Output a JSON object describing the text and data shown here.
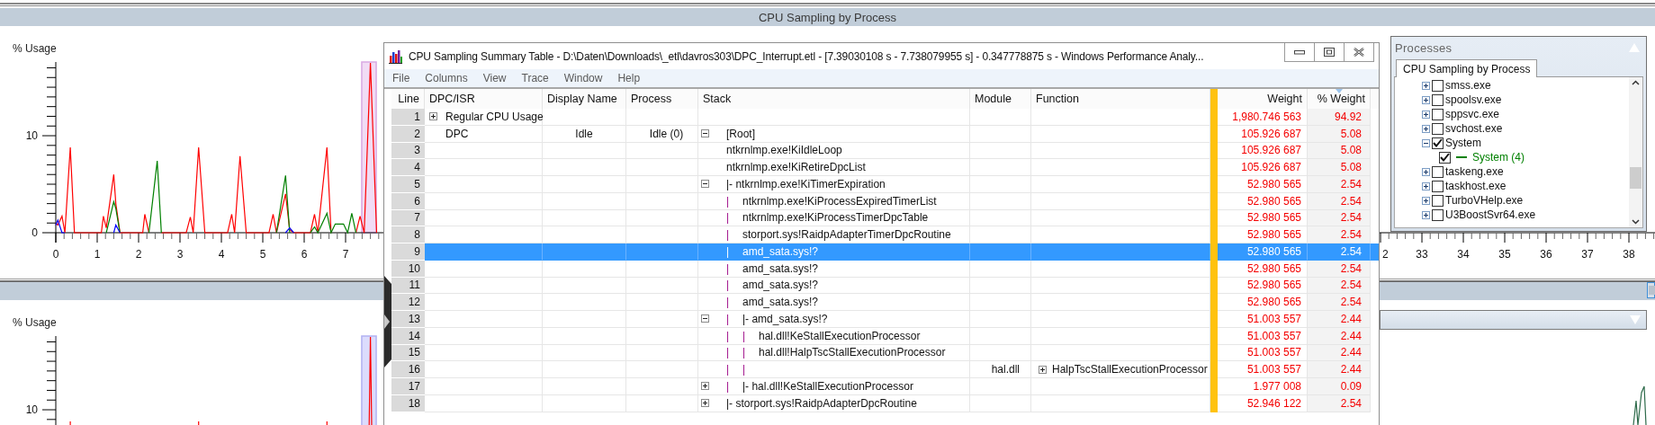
{
  "top_pane": {
    "title": "CPU Sampling by Process",
    "chart_data": {
      "type": "line",
      "ylabel": "% Usage",
      "x": [
        0,
        0.05,
        0.15,
        0.22,
        0.35,
        0.45,
        1.1,
        1.15,
        1.22,
        1.4,
        1.45,
        1.55,
        2.1,
        2.15,
        2.25,
        2.45,
        2.55,
        3.15,
        3.25,
        3.32,
        3.45,
        3.6,
        4.15,
        4.25,
        4.32,
        4.45,
        4.6,
        5.15,
        5.25,
        5.33,
        5.55,
        5.65,
        5.75,
        6.15,
        6.25,
        6.33,
        6.55,
        6.65,
        6.75,
        6.95,
        7.05,
        7.15,
        7.25,
        7.35,
        7.45,
        7.6,
        7.75
      ],
      "series": [
        {
          "color": "#ff0000",
          "values": [
            1.0,
            0.8,
            1.7,
            0,
            8.8,
            0,
            0,
            1.7,
            0.5,
            6.0,
            3.0,
            0,
            0,
            1.9,
            0,
            null,
            0,
            0,
            1.6,
            0,
            8.8,
            0,
            0,
            1.9,
            0,
            7.9,
            0,
            0,
            1.9,
            0,
            4.0,
            0.3,
            0,
            0,
            1.9,
            0,
            8.8,
            0,
            null,
            null,
            null,
            null,
            0,
            1.7,
            0,
            17.5,
            0
          ]
        },
        {
          "color": "#008000",
          "values": [
            null,
            null,
            null,
            null,
            null,
            null,
            null,
            null,
            0,
            3.2,
            2.5,
            0,
            null,
            null,
            0,
            7.4,
            0,
            null,
            null,
            null,
            null,
            null,
            null,
            null,
            null,
            null,
            null,
            null,
            null,
            0,
            5.9,
            0,
            null,
            0,
            0.6,
            0,
            2.0,
            0,
            0.9,
            0.9,
            0,
            2.0,
            0,
            null,
            null,
            null,
            null
          ]
        },
        {
          "color": "#0000ff",
          "values": [
            0.8,
            1.3,
            0,
            0,
            null,
            null,
            null,
            null,
            null,
            0,
            0.8,
            0,
            null,
            null,
            null,
            null,
            null,
            null,
            null,
            null,
            null,
            null,
            null,
            null,
            null,
            null,
            null,
            null,
            null,
            null,
            0,
            0.5,
            0,
            null,
            null,
            null,
            null,
            null,
            null,
            null,
            null,
            null,
            null,
            null,
            null,
            null,
            null
          ]
        }
      ],
      "xticks": [
        0,
        1,
        2,
        3,
        4,
        5,
        6,
        7,
        33,
        34,
        35,
        36,
        37,
        38
      ],
      "yticks": [
        0,
        10
      ],
      "xlim": [
        0,
        38.63
      ],
      "ylim": [
        0,
        17.6
      ]
    },
    "cut_tick_label": "2"
  },
  "bottom_pane": {
    "ylabel": "% Usage",
    "yticks": [
      "10"
    ]
  },
  "table_window": {
    "title": "CPU Sampling Summary Table - D:\\Daten\\Downloads\\_etl\\davros303\\DPC_Interrupt.etl - [7.39030108 s - 7.738079955 s] - 0.347778875 s - Windows Performance Analy...",
    "menu": [
      "File",
      "Columns",
      "View",
      "Trace",
      "Window",
      "Help"
    ],
    "columns": [
      {
        "label": "Line",
        "sorted": false
      },
      {
        "label": "DPC/ISR",
        "sorted": false
      },
      {
        "label": "Display Name",
        "sorted": false
      },
      {
        "label": "Process",
        "sorted": false
      },
      {
        "label": "Stack",
        "sorted": false
      },
      {
        "label": "Module",
        "sorted": false
      },
      {
        "label": "Function",
        "sorted": false
      },
      {
        "label": "Weight",
        "sorted": false
      },
      {
        "label": "% Weight",
        "sorted": true
      }
    ],
    "rows": [
      {
        "line": "1",
        "dpc_isr": {
          "text": "Regular CPU Usage",
          "expanded": false
        },
        "weight": "1,980.746 563",
        "pct_weight": "94.92",
        "selected": false
      },
      {
        "line": "2",
        "dpc_isr": {
          "text": "DPC"
        },
        "display_name": "Idle",
        "process": "Idle (0)",
        "stack": {
          "text": "[Root]",
          "expanded": true
        },
        "weight": "105.926 687",
        "pct_weight": "5.08",
        "selected": false
      },
      {
        "line": "3",
        "stack": {
          "text": "ntkrnlmp.exe!KiIdleLoop"
        },
        "weight": "105.926 687",
        "pct_weight": "5.08",
        "selected": false
      },
      {
        "line": "4",
        "stack": {
          "text": "ntkrnlmp.exe!KiRetireDpcList"
        },
        "weight": "105.926 687",
        "pct_weight": "5.08",
        "selected": false
      },
      {
        "line": "5",
        "stack": {
          "text": "|- ntkrnlmp.exe!KiTimerExpiration",
          "expanded": true
        },
        "weight": "52.980 565",
        "pct_weight": "2.54",
        "selected": false
      },
      {
        "line": "6",
        "stack": {
          "rails": [
            "|"
          ],
          "text": "ntkrnlmp.exe!KiProcessExpiredTimerList"
        },
        "weight": "52.980 565",
        "pct_weight": "2.54",
        "selected": false
      },
      {
        "line": "7",
        "stack": {
          "rails": [
            "|"
          ],
          "text": "ntkrnlmp.exe!KiProcessTimerDpcTable"
        },
        "weight": "52.980 565",
        "pct_weight": "2.54",
        "selected": false
      },
      {
        "line": "8",
        "stack": {
          "rails": [
            "|"
          ],
          "text": "storport.sys!RaidpAdapterTimerDpcRoutine"
        },
        "weight": "52.980 565",
        "pct_weight": "2.54",
        "selected": false
      },
      {
        "line": "9",
        "stack": {
          "rails": [
            "|"
          ],
          "text": "amd_sata.sys!?"
        },
        "weight": "52.980 565",
        "pct_weight": "2.54",
        "selected": true
      },
      {
        "line": "10",
        "stack": {
          "rails": [
            "|"
          ],
          "text": "amd_sata.sys!?"
        },
        "weight": "52.980 565",
        "pct_weight": "2.54",
        "selected": false
      },
      {
        "line": "11",
        "stack": {
          "rails": [
            "|"
          ],
          "text": "amd_sata.sys!?"
        },
        "weight": "52.980 565",
        "pct_weight": "2.54",
        "selected": false
      },
      {
        "line": "12",
        "stack": {
          "rails": [
            "|"
          ],
          "text": "amd_sata.sys!?"
        },
        "weight": "52.980 565",
        "pct_weight": "2.54",
        "selected": false
      },
      {
        "line": "13",
        "stack": {
          "rails": [
            "|"
          ],
          "text": "|- amd_sata.sys!?",
          "expanded": true
        },
        "weight": "51.003 557",
        "pct_weight": "2.44",
        "selected": false
      },
      {
        "line": "14",
        "stack": {
          "rails": [
            "|",
            "|"
          ],
          "text": "hal.dll!KeStallExecutionProcessor"
        },
        "weight": "51.003 557",
        "pct_weight": "2.44",
        "selected": false
      },
      {
        "line": "15",
        "stack": {
          "rails": [
            "|",
            "|"
          ],
          "text": "hal.dll!HalpTscStallExecutionProcessor"
        },
        "weight": "51.003 557",
        "pct_weight": "2.44",
        "selected": false
      },
      {
        "line": "16",
        "stack": {
          "rails": [
            "|",
            "|"
          ]
        },
        "module": "hal.dll",
        "function": {
          "text": "HalpTscStallExecutionProcessor",
          "expanded": false
        },
        "weight": "51.003 557",
        "pct_weight": "2.44",
        "selected": false
      },
      {
        "line": "17",
        "stack": {
          "rails": [
            "|"
          ],
          "text": "|- hal.dll!KeStallExecutionProcessor",
          "expanded": false
        },
        "weight": "1.977 008",
        "pct_weight": "0.09",
        "selected": false
      },
      {
        "line": "18",
        "stack": {
          "text": "|- storport.sys!RaidpAdapterDpcRoutine",
          "expanded": false
        },
        "weight": "52.946 122",
        "pct_weight": "2.54",
        "selected": false
      }
    ]
  },
  "processes_panel": {
    "title": "Processes",
    "tabs": [
      {
        "label": "CPU Sampling by Process",
        "selected": true
      }
    ],
    "items": [
      {
        "name": "smss.exe",
        "checked": false,
        "expanded": false
      },
      {
        "name": "spoolsv.exe",
        "checked": false,
        "expanded": false
      },
      {
        "name": "sppsvc.exe",
        "checked": false,
        "expanded": false
      },
      {
        "name": "svchost.exe",
        "checked": false,
        "expanded": false
      },
      {
        "name": "System",
        "checked": true,
        "expanded": true,
        "children": [
          {
            "name": "System (4)",
            "checked": true,
            "color": "#008000"
          }
        ]
      },
      {
        "name": "taskeng.exe",
        "checked": false,
        "expanded": false
      },
      {
        "name": "taskhost.exe",
        "checked": false,
        "expanded": false
      },
      {
        "name": "TurboVHelp.exe",
        "checked": false,
        "expanded": false
      },
      {
        "name": "U3BoostSvr64.exe",
        "checked": false,
        "expanded": false
      }
    ]
  }
}
